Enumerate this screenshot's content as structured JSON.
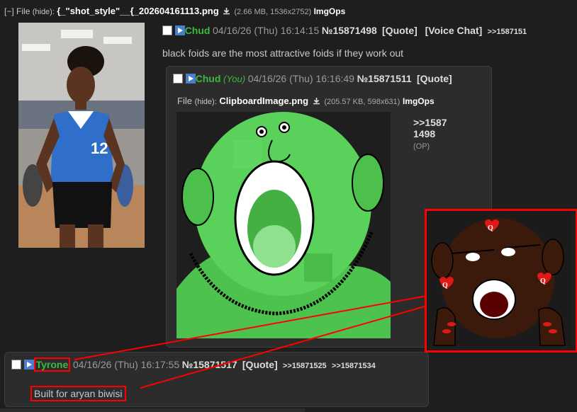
{
  "op": {
    "expand_toggle": "[−]",
    "file_label": "File",
    "hide_label": "(hide):",
    "filename": "{_\"shot_style\"__{_202604161113.png",
    "file_meta": "(2.66 MB, 1536x2752)",
    "imgops": "ImgOps",
    "name": "Chud",
    "date": "04/16/26 (Thu) 16:14:15",
    "post_no": "№15871498",
    "quote": "[Quote]",
    "voice_chat": "[Voice Chat]",
    "backlink": ">>1587151",
    "comment": "black foids are the most attractive foids if they work out"
  },
  "reply1": {
    "name": "Chud",
    "you": "(You)",
    "date": "04/16/26 (Thu) 16:16:49",
    "post_no": "№15871511",
    "quote": "[Quote]",
    "file_label": "File",
    "hide_label": "(hide):",
    "filename": "ClipboardImage.png",
    "file_meta": "(205.57 KB, 598x631)",
    "imgops": "ImgOps",
    "quotelink_line1": ">>1587",
    "quotelink_line2": "1498",
    "op_marker": "(OP)"
  },
  "reply2": {
    "name": "Tyrone",
    "date": "04/16/26 (Thu) 16:17:55",
    "post_no": "№15871517",
    "quote": "[Quote]",
    "backlink1": ">>15871525",
    "backlink2": ">>15871534",
    "comment": "Built for aryan biwisi"
  },
  "colors": {
    "background": "#1e1e1e",
    "post_bg": "#2c2c2c",
    "name_green": "#3eb83e",
    "annotation_red": "#ff0000"
  }
}
